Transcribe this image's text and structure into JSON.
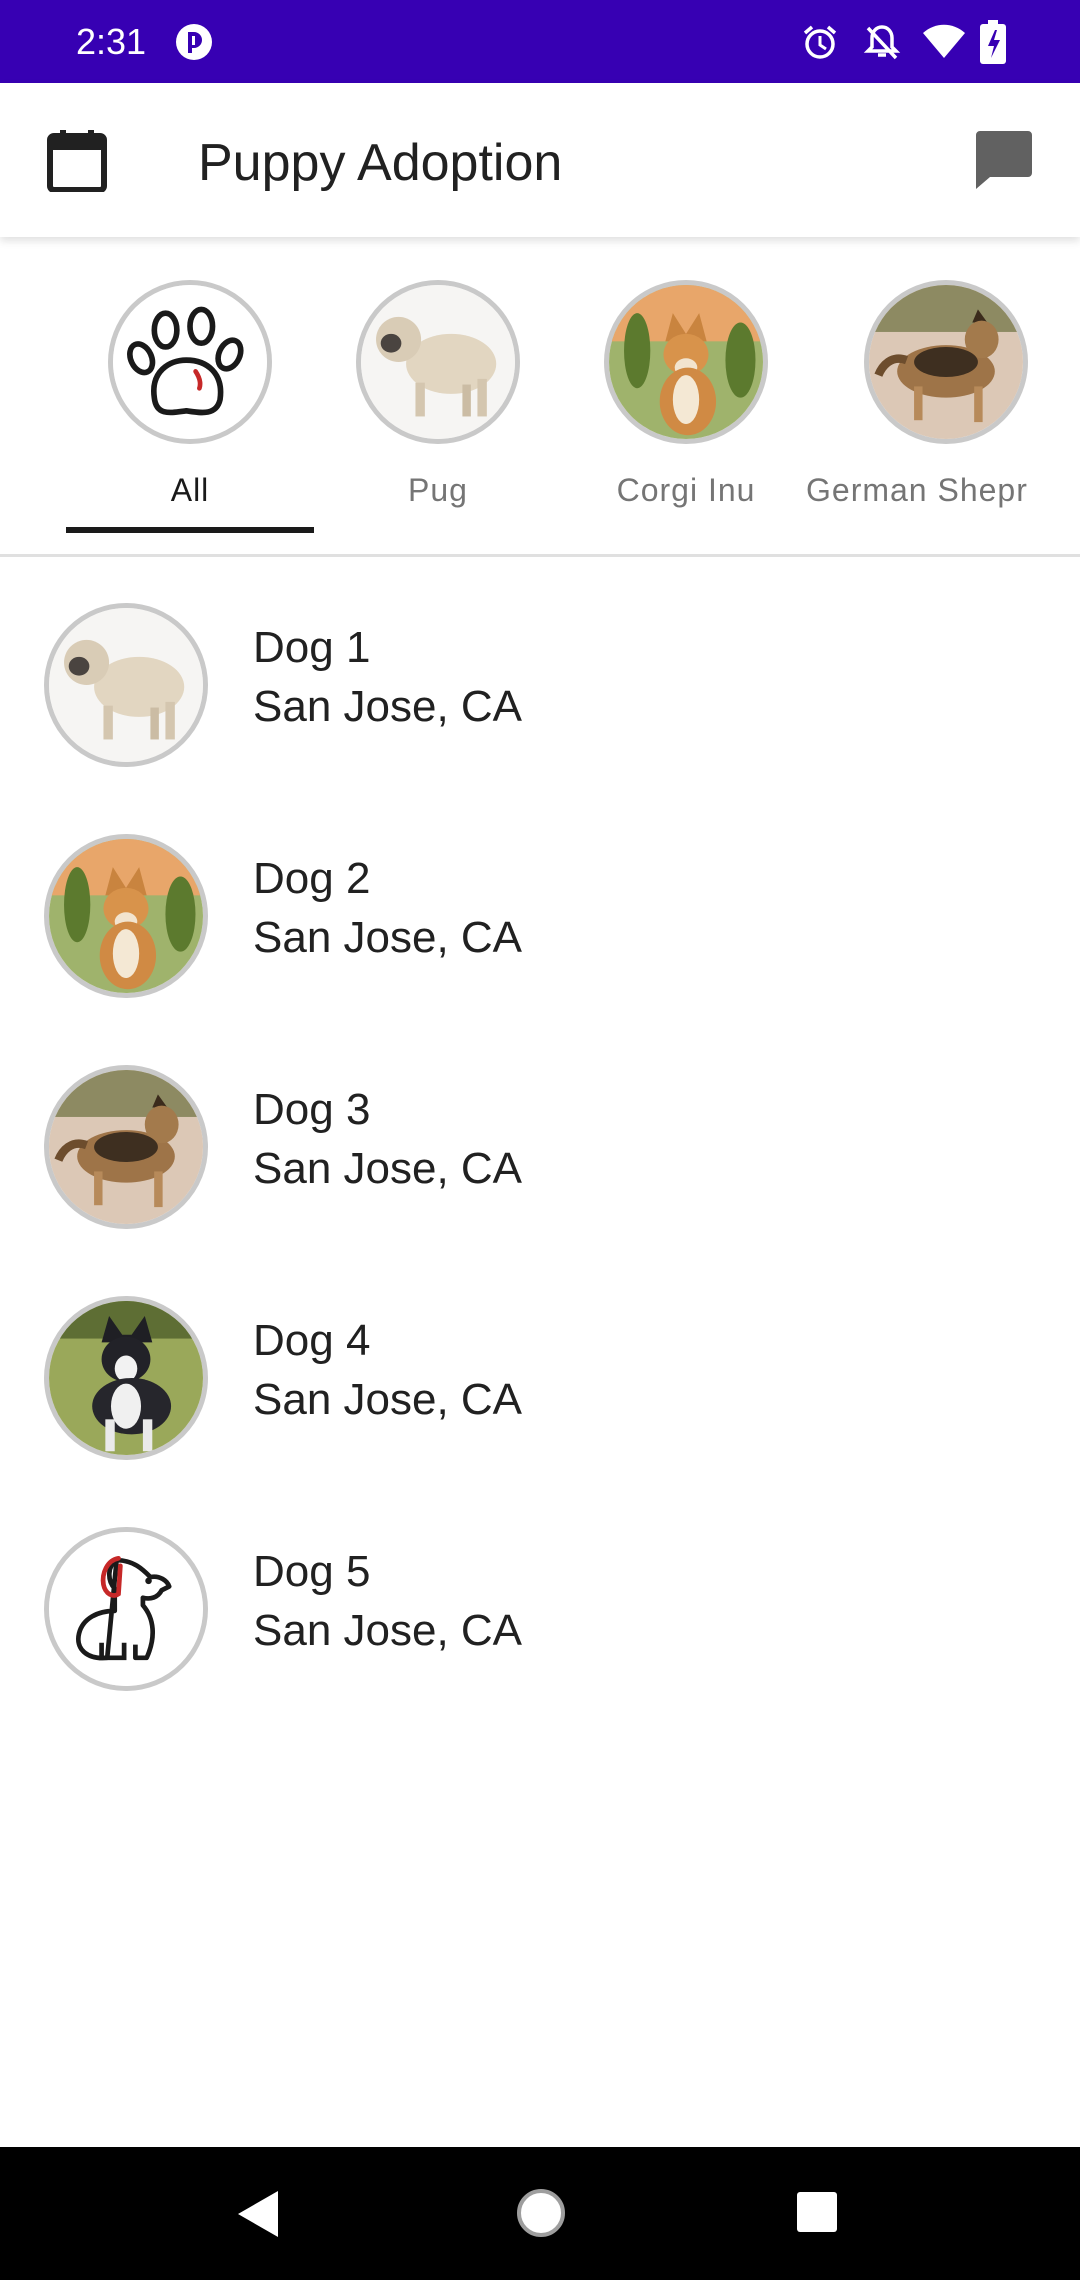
{
  "status_bar": {
    "time": "2:31",
    "icons": [
      "app-notification-icon",
      "alarm-icon",
      "do-not-disturb-icon",
      "wifi-icon",
      "battery-charging-icon"
    ]
  },
  "app_bar": {
    "title": "Puppy Adoption",
    "left_icon": "calendar-icon",
    "right_icon": "chat-icon"
  },
  "tabs": [
    {
      "label": "All",
      "icon": "paw-icon",
      "selected": true
    },
    {
      "label": "Pug",
      "icon": "pug-photo",
      "selected": false
    },
    {
      "label": "Corgi Inu",
      "icon": "corgi-photo",
      "selected": false
    },
    {
      "label": "German Shepr",
      "icon": "german-shepherd-photo",
      "selected": false
    }
  ],
  "dogs": [
    {
      "name": "Dog 1",
      "location": "San Jose, CA",
      "photo": "pug-photo"
    },
    {
      "name": "Dog 2",
      "location": "San Jose, CA",
      "photo": "corgi-photo"
    },
    {
      "name": "Dog 3",
      "location": "San Jose, CA",
      "photo": "german-shepherd-photo"
    },
    {
      "name": "Dog 4",
      "location": "San Jose, CA",
      "photo": "husky-photo"
    },
    {
      "name": "Dog 5",
      "location": "San Jose, CA",
      "photo": "dog-outline-icon"
    }
  ],
  "nav_bar": {
    "icons": [
      "back-icon",
      "home-icon",
      "recents-icon"
    ]
  },
  "colors": {
    "status_bar": "#3700b3",
    "avatar_border": "#c9c9c9",
    "tab_indicator": "#1a1a1a",
    "leash_red": "#c62828"
  }
}
